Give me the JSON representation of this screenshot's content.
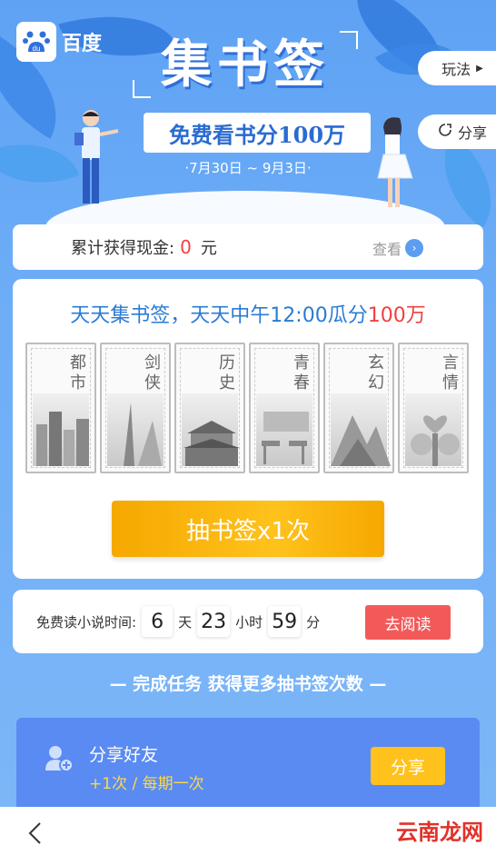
{
  "header": {
    "logo_text": "百度",
    "title": "集书签",
    "subtitle": "免费看书分100万",
    "dates": "·7月30日 ~ 9月3日·",
    "rules_label": "玩法",
    "share_label": "分享"
  },
  "cash": {
    "label": "累计获得现金:",
    "amount": "0",
    "unit": "元",
    "view_label": "查看"
  },
  "draw_card": {
    "title_prefix": "天天集书签，天天中午12:00瓜分",
    "title_highlight": "100万",
    "bookmarks": [
      {
        "label": "都市",
        "icon": "city-icon"
      },
      {
        "label": "剑侠",
        "icon": "sword-icon"
      },
      {
        "label": "历史",
        "icon": "palace-icon"
      },
      {
        "label": "青春",
        "icon": "classroom-icon"
      },
      {
        "label": "玄幻",
        "icon": "mountain-icon"
      },
      {
        "label": "言情",
        "icon": "heart-tree-icon"
      }
    ],
    "draw_button": "抽书签x1次"
  },
  "timer": {
    "label": "免费读小说时间:",
    "days": "6",
    "days_unit": "天",
    "hours": "23",
    "hours_unit": "小时",
    "minutes": "59",
    "minutes_unit": "分",
    "read_button": "去阅读"
  },
  "tasks": {
    "title": "— 完成任务 获得更多抽书签次数 —",
    "items": [
      {
        "title": "分享好友",
        "subtitle": "+1次 / 每期一次",
        "button": "分享",
        "icon": "add-friend-icon"
      }
    ]
  },
  "bottom": {
    "back_icon": "back-arrow-icon",
    "watermark": "云南龙网"
  },
  "colors": {
    "accent_blue": "#2a7bd5",
    "highlight_red": "#f04141",
    "button_yellow": "#ffc21c",
    "read_red": "#f25a5a"
  }
}
